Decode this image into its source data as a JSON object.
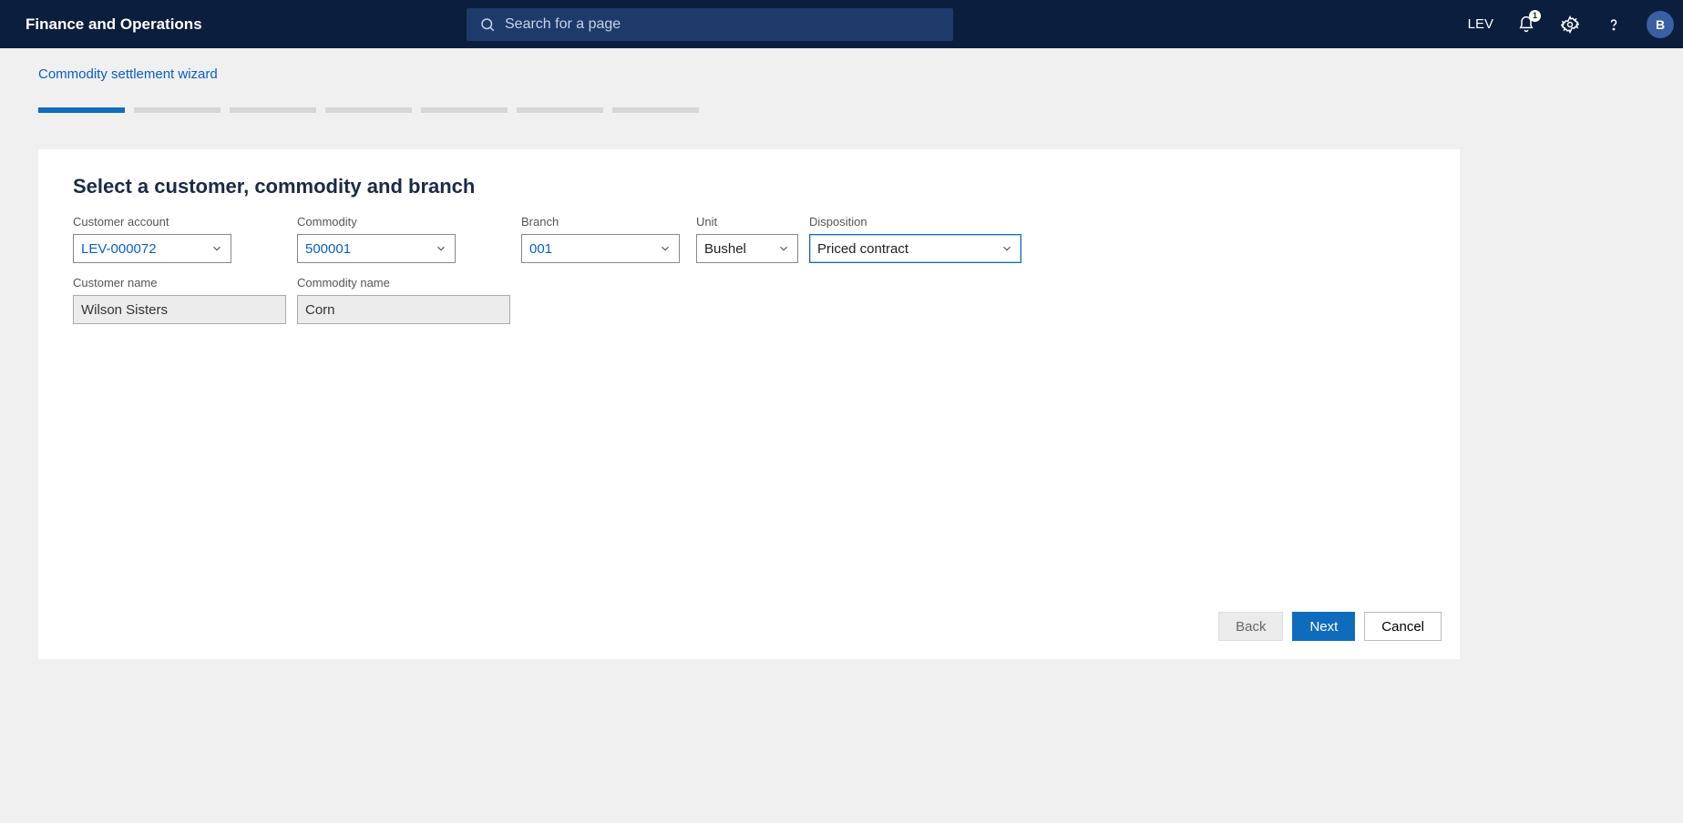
{
  "header": {
    "app_title": "Finance and Operations",
    "search_placeholder": "Search for a page",
    "env": "LEV",
    "notif_count": "1",
    "avatar_initial": "B"
  },
  "breadcrumb": "Commodity settlement wizard",
  "progress": {
    "total": 7,
    "active_index": 0
  },
  "card": {
    "title": "Select a customer, commodity and branch",
    "fields": {
      "customer_account": {
        "label": "Customer account",
        "value": "LEV-000072"
      },
      "commodity": {
        "label": "Commodity",
        "value": "500001"
      },
      "branch": {
        "label": "Branch",
        "value": "001"
      },
      "unit": {
        "label": "Unit",
        "value": "Bushel"
      },
      "disposition": {
        "label": "Disposition",
        "value": "Priced contract"
      },
      "customer_name": {
        "label": "Customer name",
        "value": "Wilson Sisters"
      },
      "commodity_name": {
        "label": "Commodity name",
        "value": "Corn"
      }
    }
  },
  "footer": {
    "back": "Back",
    "next": "Next",
    "cancel": "Cancel"
  }
}
